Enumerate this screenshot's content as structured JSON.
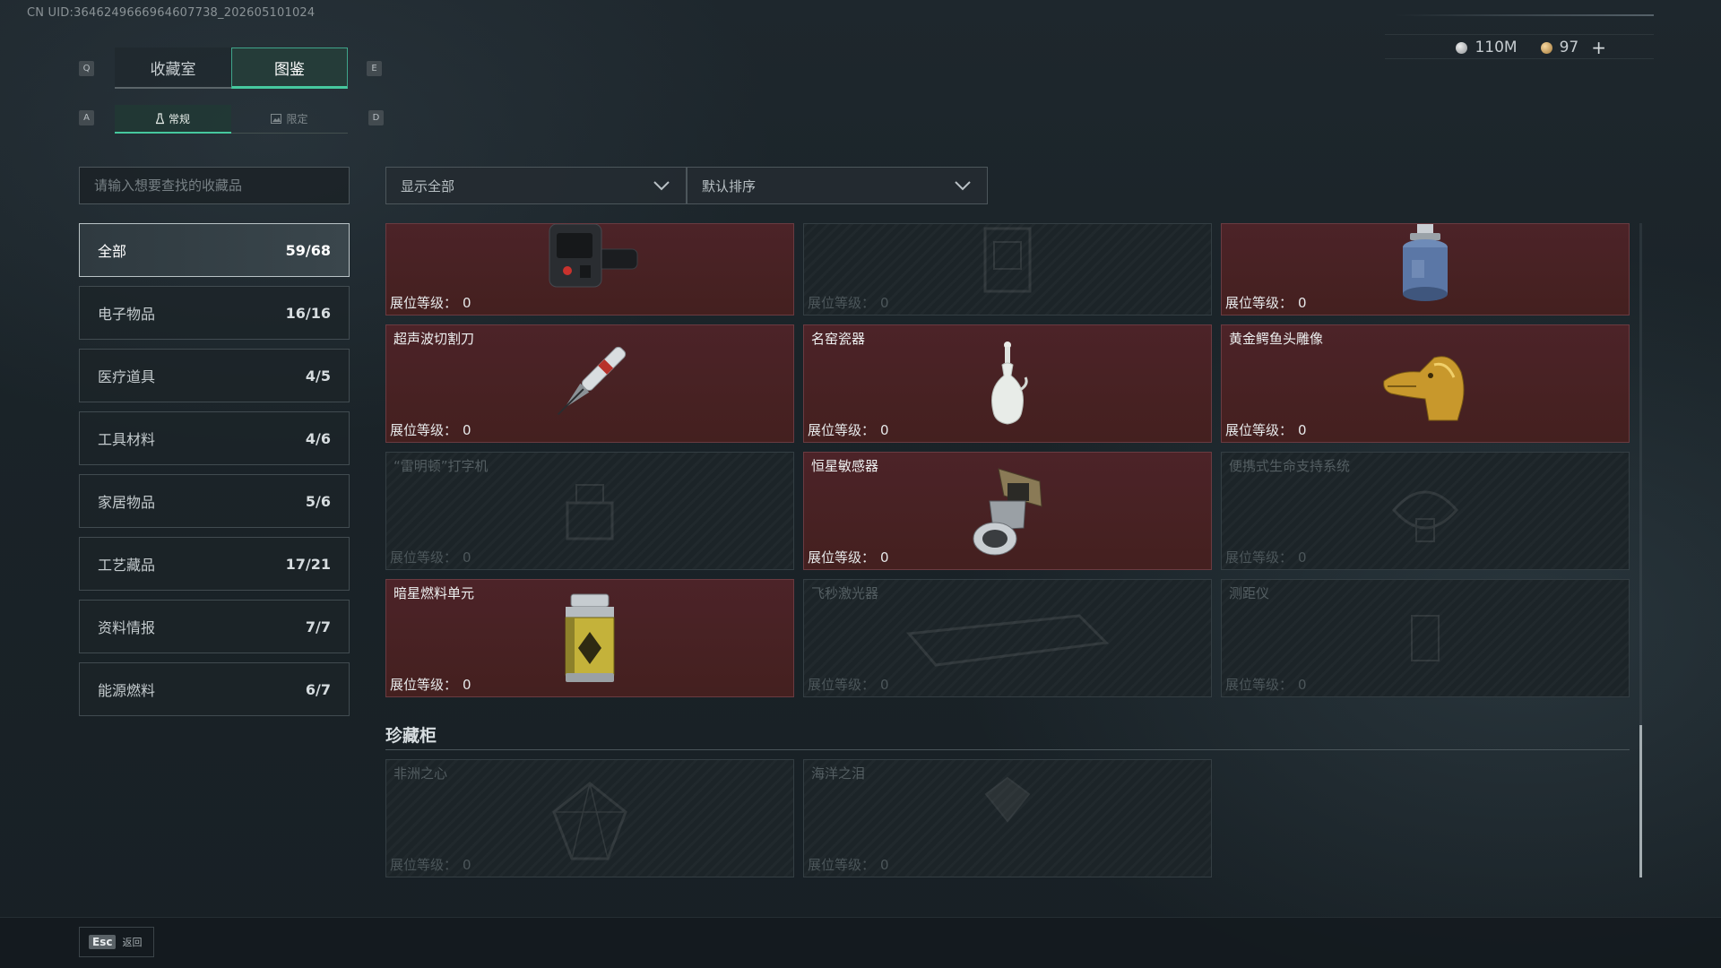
{
  "uid_text": "CN UID:3646249666964607738_202605101024",
  "currency": {
    "silver": "110M",
    "gold": "97",
    "add_symbol": "+"
  },
  "keys": {
    "prev_tab": "Q",
    "next_tab": "E",
    "prev_subtab": "A",
    "next_subtab": "D"
  },
  "tabs": [
    {
      "label": "收藏室",
      "active": false
    },
    {
      "label": "图鉴",
      "active": true
    }
  ],
  "subtabs": [
    {
      "label": "常规",
      "active": true
    },
    {
      "label": "限定",
      "active": false
    }
  ],
  "search": {
    "placeholder": "请输入想要查找的收藏品"
  },
  "filters": {
    "display": "显示全部",
    "sort": "默认排序"
  },
  "categories": [
    {
      "label": "全部",
      "count": "59/68",
      "active": true
    },
    {
      "label": "电子物品",
      "count": "16/16",
      "active": false
    },
    {
      "label": "医疗道具",
      "count": "4/5",
      "active": false
    },
    {
      "label": "工具材料",
      "count": "4/6",
      "active": false
    },
    {
      "label": "家居物品",
      "count": "5/6",
      "active": false
    },
    {
      "label": "工艺藏品",
      "count": "17/21",
      "active": false
    },
    {
      "label": "资料情报",
      "count": "7/7",
      "active": false
    },
    {
      "label": "能源燃料",
      "count": "6/7",
      "active": false
    }
  ],
  "level_label": "展位等级：",
  "items": [
    {
      "name": "",
      "level": "0",
      "owned": true,
      "icon": "wrist-device-icon"
    },
    {
      "name": "",
      "level": "0",
      "owned": false,
      "icon": "unknown-item-icon"
    },
    {
      "name": "",
      "level": "0",
      "owned": true,
      "icon": "gas-canister-icon"
    },
    {
      "name": "超声波切割刀",
      "level": "0",
      "owned": true,
      "icon": "ultrasonic-cutter-icon"
    },
    {
      "name": "名窑瓷器",
      "level": "0",
      "owned": true,
      "icon": "porcelain-vase-icon"
    },
    {
      "name": "黄金鳄鱼头雕像",
      "level": "0",
      "owned": true,
      "icon": "gold-crocodile-statue-icon"
    },
    {
      "name": "“雷明顿”打字机",
      "level": "0",
      "owned": false,
      "icon": "typewriter-icon"
    },
    {
      "name": "恒星敏感器",
      "level": "0",
      "owned": true,
      "icon": "star-sensor-icon"
    },
    {
      "name": "便携式生命支持系统",
      "level": "0",
      "owned": false,
      "icon": "life-support-icon"
    },
    {
      "name": "暗星燃料单元",
      "level": "0",
      "owned": true,
      "icon": "fuel-cell-icon"
    },
    {
      "name": "飞秒激光器",
      "level": "0",
      "owned": false,
      "icon": "femtosecond-laser-icon"
    },
    {
      "name": "测距仪",
      "level": "0",
      "owned": false,
      "icon": "rangefinder-icon"
    }
  ],
  "cabinet": {
    "title": "珍藏柜",
    "items": [
      {
        "name": "非洲之心",
        "level": "0",
        "owned": false,
        "icon": "diamond-icon"
      },
      {
        "name": "海洋之泪",
        "level": "0",
        "owned": false,
        "icon": "gem-icon"
      }
    ]
  },
  "footer": {
    "esc_key": "Esc",
    "esc_label": "返回"
  },
  "colors": {
    "accent": "#46c89e",
    "owned_card": "#4a2227",
    "locked_card": "#1c2428"
  }
}
